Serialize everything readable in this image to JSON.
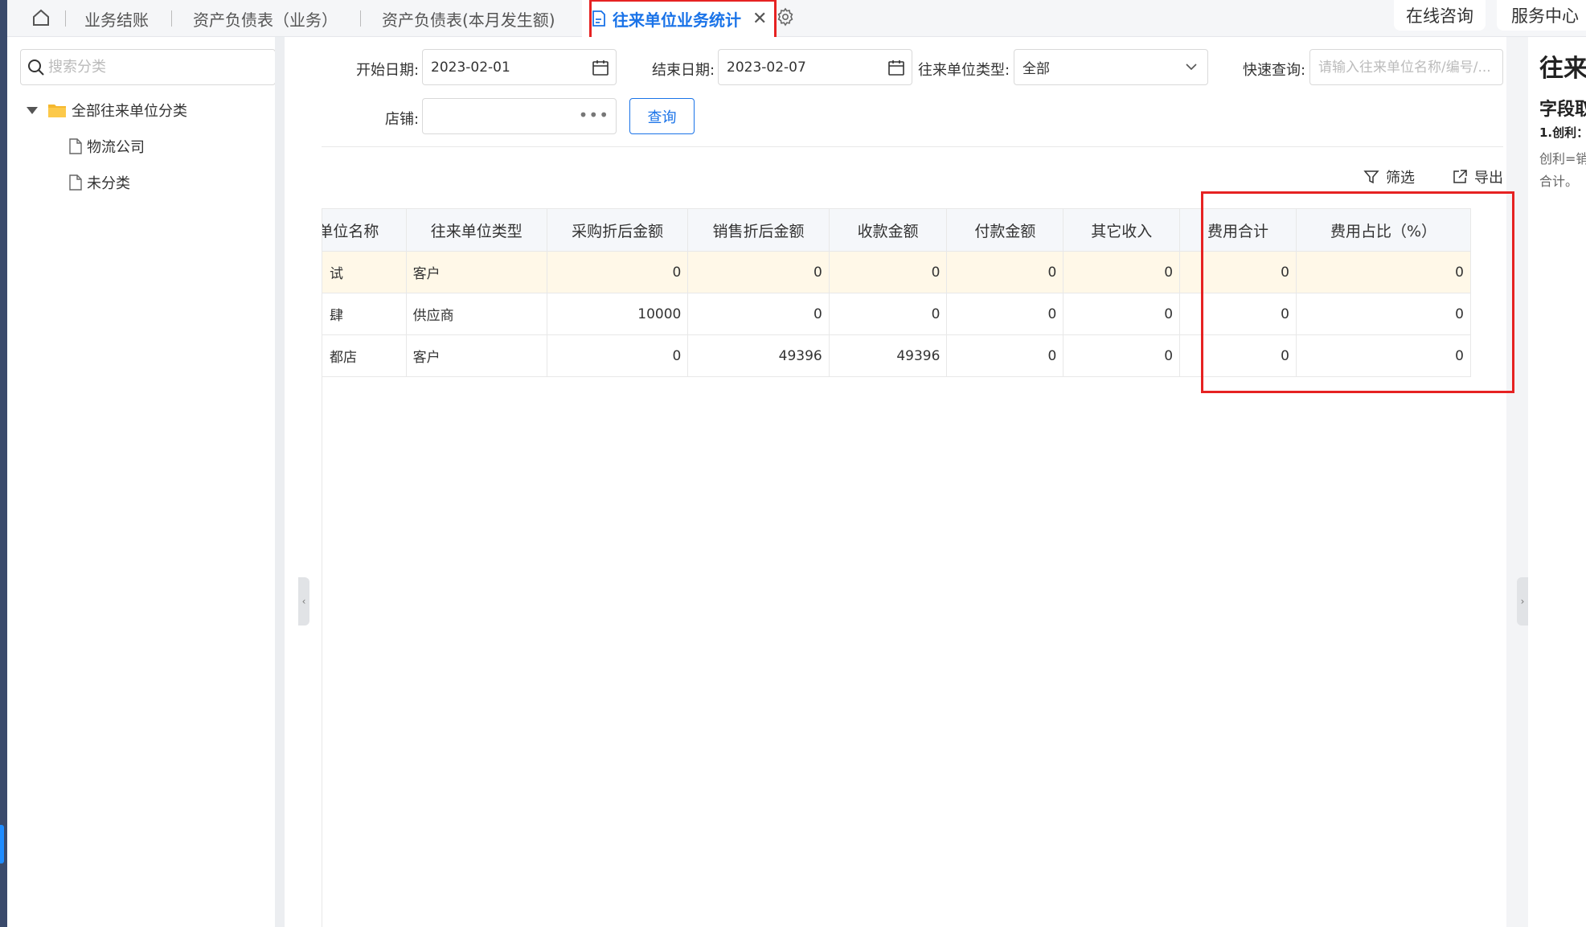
{
  "tabs": {
    "items": [
      {
        "label": "业务结账"
      },
      {
        "label": "资产负债表（业务）"
      },
      {
        "label": "资产负债表(本月发生额)"
      }
    ],
    "active": {
      "label": "往来单位业务统计",
      "close": "✕"
    }
  },
  "top_buttons": {
    "consult": "在线咨询",
    "service": "服务中心"
  },
  "sidebar": {
    "search_placeholder": "搜索分类",
    "root": "全部往来单位分类",
    "children": [
      "物流公司",
      "未分类"
    ]
  },
  "filters": {
    "start_label": "开始日期:",
    "start_value": "2023-02-01",
    "end_label": "结束日期:",
    "end_value": "2023-02-07",
    "type_label": "往来单位类型:",
    "type_value": "全部",
    "quick_label": "快速查询:",
    "quick_placeholder": "请输入往来单位名称/编号/...",
    "shop_label": "店铺:",
    "shop_value": "",
    "query_button": "查询"
  },
  "toolbar": {
    "filter": "筛选",
    "export": "导出"
  },
  "table": {
    "headers": [
      "单位名称",
      "往来单位类型",
      "采购折后金额",
      "销售折后金额",
      "收款金额",
      "付款金额",
      "其它收入",
      "费用合计",
      "费用占比（%）"
    ],
    "rows": [
      [
        "试",
        "客户",
        "0",
        "0",
        "0",
        "0",
        "0",
        "0",
        "0"
      ],
      [
        "肆",
        "供应商",
        "10000",
        "0",
        "0",
        "0",
        "0",
        "0",
        "0"
      ],
      [
        "都店",
        "客户",
        "0",
        "49396",
        "49396",
        "0",
        "0",
        "0",
        "0"
      ]
    ]
  },
  "help_panel": {
    "title": "往来",
    "subtitle": "字段取",
    "item": "1.创利：",
    "text_line1": "创利=销",
    "text_line2": "合计。"
  },
  "colors": {
    "accent": "#1a73e8",
    "highlight": "#e62222",
    "first_row_bg": "#fff8e8"
  }
}
